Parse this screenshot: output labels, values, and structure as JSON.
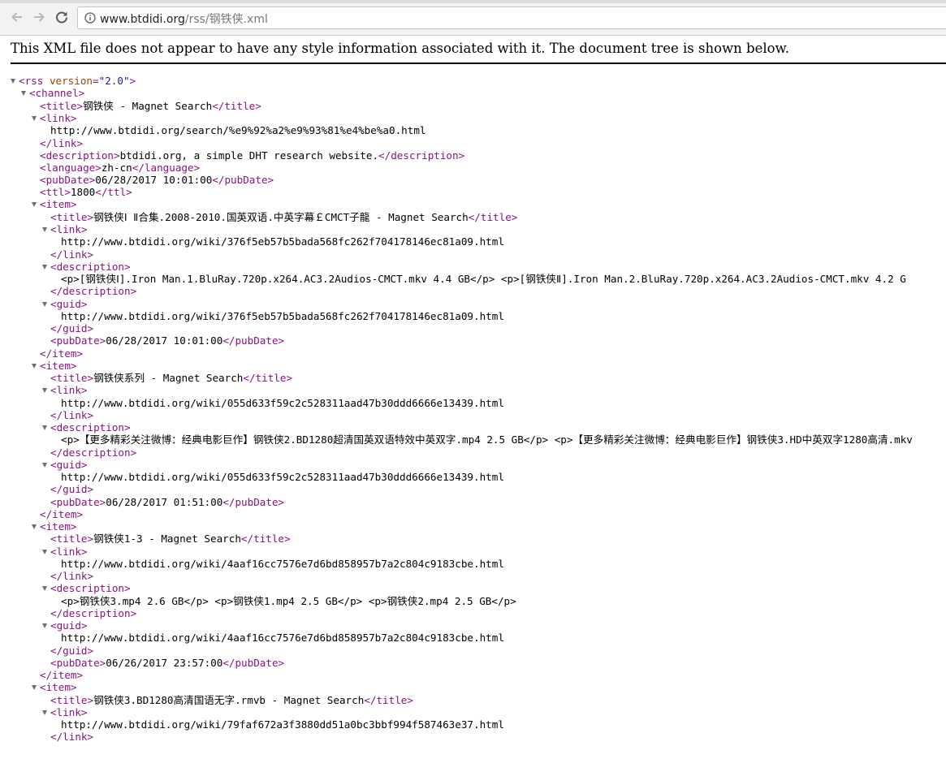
{
  "browser": {
    "url_host": "www.btdidi.org",
    "url_path": "/rss/钢铁侠.xml"
  },
  "viewer": {
    "notice": "This XML file does not appear to have any style information associated with it. The document tree is shown below."
  },
  "rss": {
    "open_tag_name": "<rss",
    "version_attr": "version",
    "version_value": "\"2.0\"",
    "open_tag_end": ">"
  },
  "tags": {
    "channel_open": "<channel>",
    "title_open": "<title>",
    "title_close": "</title>",
    "link_open": "<link>",
    "link_close": "</link>",
    "description_open": "<description>",
    "description_close": "</description>",
    "language_open": "<language>",
    "language_close": "</language>",
    "pubdate_open": "<pubDate>",
    "pubdate_close": "</pubDate>",
    "ttl_open": "<ttl>",
    "ttl_close": "</ttl>",
    "item_open": "<item>",
    "item_close": "</item>",
    "guid_open": "<guid>",
    "guid_close": "</guid>"
  },
  "channel": {
    "title": "钢铁侠 - Magnet Search",
    "link": "http://www.btdidi.org/search/%e9%92%a2%e9%93%81%e4%be%a0.html",
    "description": "btdidi.org, a simple DHT research website.",
    "language": "zh-cn",
    "pubDate": "06/28/2017 10:01:00",
    "ttl": "1800"
  },
  "items": [
    {
      "title": "钢铁侠Ⅰ Ⅱ合集.2008-2010.国英双语.中英字幕￡CMCT子龍 - Magnet Search",
      "link": "http://www.btdidi.org/wiki/376f5eb57b5bada568fc262f704178146ec81a09.html",
      "description": "<p>[钢铁侠Ⅰ].Iron Man.1.BluRay.720p.x264.AC3.2Audios-CMCT.mkv 4.4 GB</p> <p>[钢铁侠Ⅱ].Iron Man.2.BluRay.720p.x264.AC3.2Audios-CMCT.mkv 4.2 G",
      "guid": "http://www.btdidi.org/wiki/376f5eb57b5bada568fc262f704178146ec81a09.html",
      "pubDate": "06/28/2017 10:01:00"
    },
    {
      "title": "钢铁侠系列 - Magnet Search",
      "link": "http://www.btdidi.org/wiki/055d633f59c2c528311aad47b30ddd6666e13439.html",
      "description": "<p>【更多精彩关注微博：经典电影巨作】钢铁侠2.BD1280超清国英双语特效中英双字.mp4 2.5 GB</p> <p>【更多精彩关注微博：经典电影巨作】钢铁侠3.HD中英双字1280高清.mkv",
      "guid": "http://www.btdidi.org/wiki/055d633f59c2c528311aad47b30ddd6666e13439.html",
      "pubDate": "06/28/2017 01:51:00"
    },
    {
      "title": "钢铁侠1-3 - Magnet Search",
      "link": "http://www.btdidi.org/wiki/4aaf16cc7576e7d6bd858957b7a2c804c9183cbe.html",
      "description": "<p>钢铁侠3.mp4 2.6 GB</p> <p>钢铁侠1.mp4 2.5 GB</p> <p>钢铁侠2.mp4 2.5 GB</p>",
      "guid": "http://www.btdidi.org/wiki/4aaf16cc7576e7d6bd858957b7a2c804c9183cbe.html",
      "pubDate": "06/26/2017 23:57:00"
    },
    {
      "title": "钢铁侠3.BD1280高清国语无字.rmvb - Magnet Search",
      "link": "http://www.btdidi.org/wiki/79faf672a3f3880dd51a0bc3bbf994f587463e37.html"
    }
  ]
}
